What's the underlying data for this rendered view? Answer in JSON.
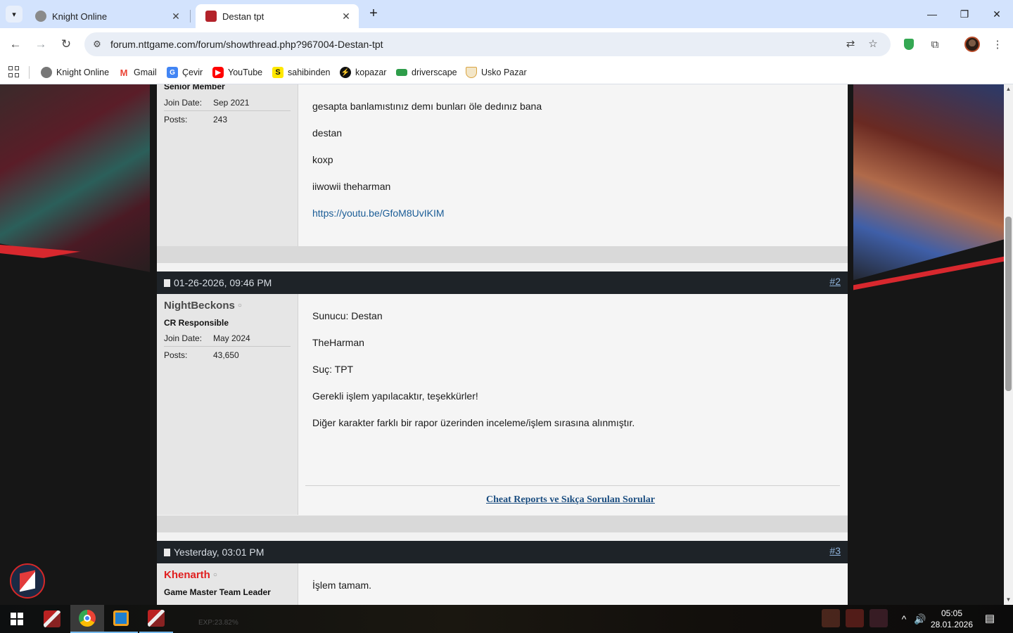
{
  "browser": {
    "tabs": [
      {
        "title": "Knight Online",
        "favicon_color": "#8a8a8a",
        "active": false
      },
      {
        "title": "Destan tpt",
        "favicon_color": "#b3222a",
        "active": true
      }
    ],
    "url": "forum.nttgame.com/forum/showthread.php?967004-Destan-tpt",
    "bookmarks": [
      {
        "label": "Knight Online",
        "icon": "knight-online-icon",
        "color": "#777777"
      },
      {
        "label": "Gmail",
        "icon": "gmail-icon",
        "color": "#ea4335"
      },
      {
        "label": "Çevir",
        "icon": "translate-icon",
        "color": "#4285f4"
      },
      {
        "label": "YouTube",
        "icon": "youtube-icon",
        "color": "#ff0000"
      },
      {
        "label": "sahibinden",
        "icon": "sahibinden-icon",
        "color": "#ffe800"
      },
      {
        "label": "kopazar",
        "icon": "kopazar-icon",
        "color": "#111111"
      },
      {
        "label": "driverscape",
        "icon": "driverscape-icon",
        "color": "#2e9d4a"
      },
      {
        "label": "Usko Pazar",
        "icon": "usko-pazar-icon",
        "color": "#d9a441"
      }
    ]
  },
  "thread": {
    "posts": [
      {
        "user_title": "Senior Member",
        "join_label": "Join Date:",
        "join_date": "Sep 2021",
        "posts_label": "Posts:",
        "posts_count": "243",
        "lines": [
          "gesapta banlamıstınız demı bunları öle dedınız bana",
          "destan",
          "koxp",
          "iiwowii theharman"
        ],
        "link": "https://youtu.be/GfoM8UvIKIM"
      },
      {
        "date": "01-26-2026, 09:46 PM",
        "number": "#2",
        "username": "NightBeckons",
        "user_title": "CR Responsible",
        "join_label": "Join Date:",
        "join_date": "May 2024",
        "posts_label": "Posts:",
        "posts_count": "43,650",
        "lines": [
          "Sunucu: Destan",
          "TheHarman",
          "Suç: TPT",
          "Gerekli işlem yapılacaktır, teşekkürler!",
          "Diğer karakter farklı bir rapor üzerinden inceleme/işlem sırasına alınmıştır."
        ],
        "signature_link": "Cheat Reports ve Sıkça Sorulan Sorular"
      },
      {
        "date": "Yesterday, 03:01 PM",
        "number": "#3",
        "username": "Khenarth",
        "user_title": "Game Master Team Leader",
        "lines": [
          "İşlem tamam."
        ]
      }
    ],
    "status_symbol": "○"
  },
  "taskbar": {
    "exp_text": "EXP:23.82%",
    "time": "05:05",
    "date": "28.01.2026"
  }
}
